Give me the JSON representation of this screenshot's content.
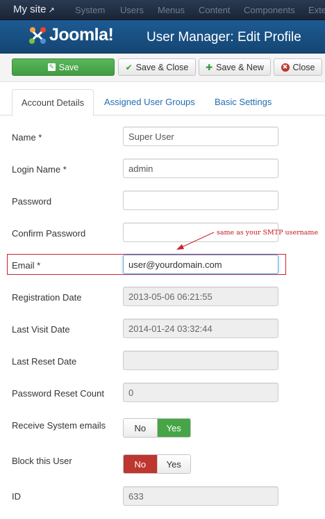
{
  "topbar": {
    "site": "My site",
    "menu": [
      "System",
      "Users",
      "Menus",
      "Content",
      "Components",
      "Exte"
    ]
  },
  "header": {
    "brand": "Joomla!",
    "title": "User Manager: Edit Profile"
  },
  "toolbar": {
    "save": "Save",
    "save_close": "Save & Close",
    "save_new": "Save & New",
    "close": "Close"
  },
  "tabs": {
    "account": "Account Details",
    "groups": "Assigned User Groups",
    "basic": "Basic Settings"
  },
  "form": {
    "name_label": "Name *",
    "name_value": "Super User",
    "login_label": "Login Name *",
    "login_value": "admin",
    "password_label": "Password",
    "password_value": "",
    "confirm_label": "Confirm Password",
    "confirm_value": "",
    "email_label": "Email *",
    "email_value": "user@yourdomain.com",
    "regdate_label": "Registration Date",
    "regdate_value": "2013-05-06 06:21:55",
    "lastvisit_label": "Last Visit Date",
    "lastvisit_value": "2014-01-24 03:32:44",
    "lastreset_label": "Last Reset Date",
    "lastreset_value": "",
    "resetcount_label": "Password Reset Count",
    "resetcount_value": "0",
    "sysemails_label": "Receive System emails",
    "sysemails_no": "No",
    "sysemails_yes": "Yes",
    "block_label": "Block this User",
    "block_no": "No",
    "block_yes": "Yes",
    "id_label": "ID",
    "id_value": "633"
  },
  "annotation": "same as your SMTP username",
  "colors": {
    "accent_green": "#46a546",
    "accent_red": "#bd362f",
    "link_blue": "#1f6db0",
    "annotation_red": "#c8232c"
  },
  "icons": [
    "external-link-icon",
    "joomla-logo-icon",
    "save-icon",
    "check-icon",
    "plus-icon",
    "close-circle-icon"
  ]
}
